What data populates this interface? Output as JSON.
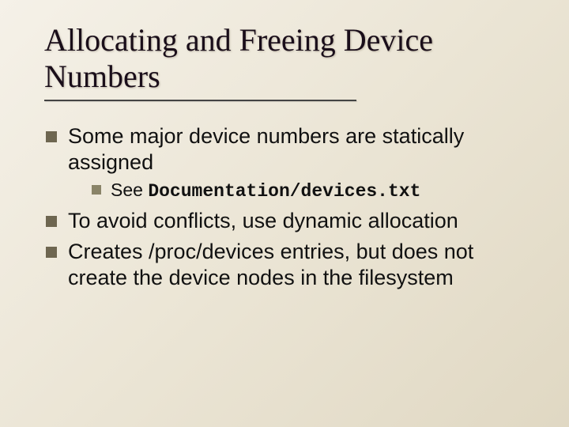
{
  "title": "Allocating and Freeing Device Numbers",
  "bullets": {
    "b1": "Some major device numbers are statically assigned",
    "b1_sub": {
      "prefix": "See ",
      "code": "Documentation/devices.txt"
    },
    "b2": "To avoid conflicts, use dynamic allocation",
    "b3": "Creates /proc/devices entries, but does not create the device nodes in the filesystem"
  }
}
